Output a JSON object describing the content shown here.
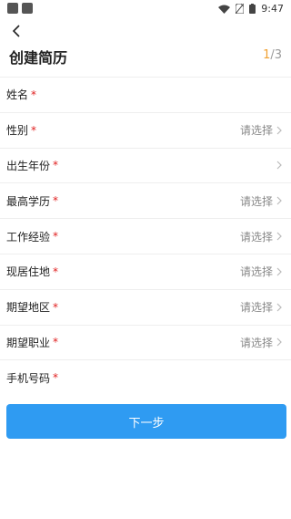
{
  "status_bar": {
    "time": "9:47",
    "icons": [
      "app-square-icon",
      "app-square-icon",
      "wifi-icon",
      "no-sim-icon",
      "battery-icon"
    ]
  },
  "header": {
    "title": "创建简历",
    "pager_current": "1",
    "pager_total": "/3"
  },
  "form": {
    "rows": [
      {
        "label": "姓名",
        "required": "*",
        "value": ""
      },
      {
        "label": "性别",
        "required": "*",
        "value": "请选择"
      },
      {
        "label": "出生年份",
        "required": "*",
        "value": ""
      },
      {
        "label": "最高学历",
        "required": "*",
        "value": "请选择"
      },
      {
        "label": "工作经验",
        "required": "*",
        "value": "请选择"
      },
      {
        "label": "现居住地",
        "required": "*",
        "value": "请选择"
      },
      {
        "label": "期望地区",
        "required": "*",
        "value": "请选择"
      },
      {
        "label": "期望职业",
        "required": "*",
        "value": "请选择"
      },
      {
        "label": "手机号码",
        "required": "*",
        "value": ""
      }
    ]
  },
  "actions": {
    "next_label": "下一步"
  },
  "colors": {
    "primary": "#2f9bf2",
    "required": "#e02020",
    "pager_highlight": "#f0a030"
  }
}
